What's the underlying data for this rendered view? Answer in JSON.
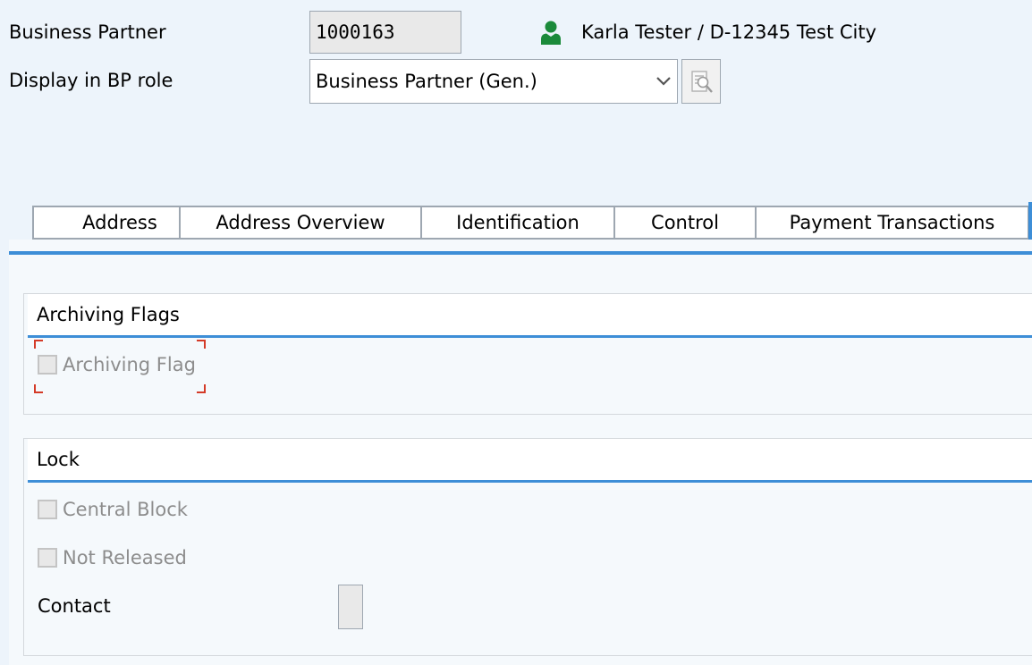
{
  "header": {
    "bp_label": "Business Partner",
    "bp_number": "1000163",
    "bp_description": "Karla Tester / D-12345 Test City",
    "role_label": "Display in BP role",
    "role_value": "Business Partner (Gen.)",
    "person_icon": "person-icon",
    "role_button_icon": "display-role-icon"
  },
  "tabs": [
    {
      "label": "Address"
    },
    {
      "label": "Address Overview"
    },
    {
      "label": "Identification"
    },
    {
      "label": "Control"
    },
    {
      "label": "Payment Transactions"
    }
  ],
  "archiving": {
    "title": "Archiving Flags",
    "flag_label": "Archiving Flag",
    "flag_checked": false
  },
  "lock": {
    "title": "Lock",
    "central_block_label": "Central Block",
    "central_block_checked": false,
    "not_released_label": "Not Released",
    "not_released_checked": false,
    "contact_label": "Contact"
  },
  "colors": {
    "accent": "#3d8ed7",
    "background": "#edf4fb",
    "person_icon": "#1b8a3a",
    "focus_corners": "#d43b28"
  }
}
